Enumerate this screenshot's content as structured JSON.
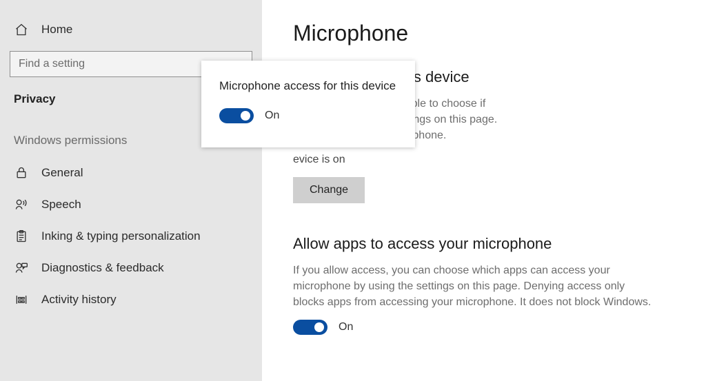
{
  "sidebar": {
    "home_label": "Home",
    "search_placeholder": "Find a setting",
    "section_title": "Privacy",
    "group_title": "Windows permissions",
    "items": [
      {
        "label": "General"
      },
      {
        "label": "Speech"
      },
      {
        "label": "Inking & typing personalization"
      },
      {
        "label": "Diagnostics & feedback"
      },
      {
        "label": "Activity history"
      }
    ]
  },
  "main": {
    "page_title": "Microphone",
    "section1": {
      "heading_suffix": "microphone on this device",
      "body_l1": "sing this device will be able to choose if",
      "body_l2": "access by using the settings on this page.",
      "body_l3": "rom accessing the microphone.",
      "status_suffix": "evice is on",
      "change_label": "Change"
    },
    "section2": {
      "heading": "Allow apps to access your microphone",
      "body": "If you allow access, you can choose which apps can access your microphone by using the settings on this page. Denying access only blocks apps from accessing your microphone. It does not block Windows.",
      "toggle_state": "On"
    }
  },
  "popup": {
    "title": "Microphone access for this device",
    "toggle_state": "On"
  }
}
